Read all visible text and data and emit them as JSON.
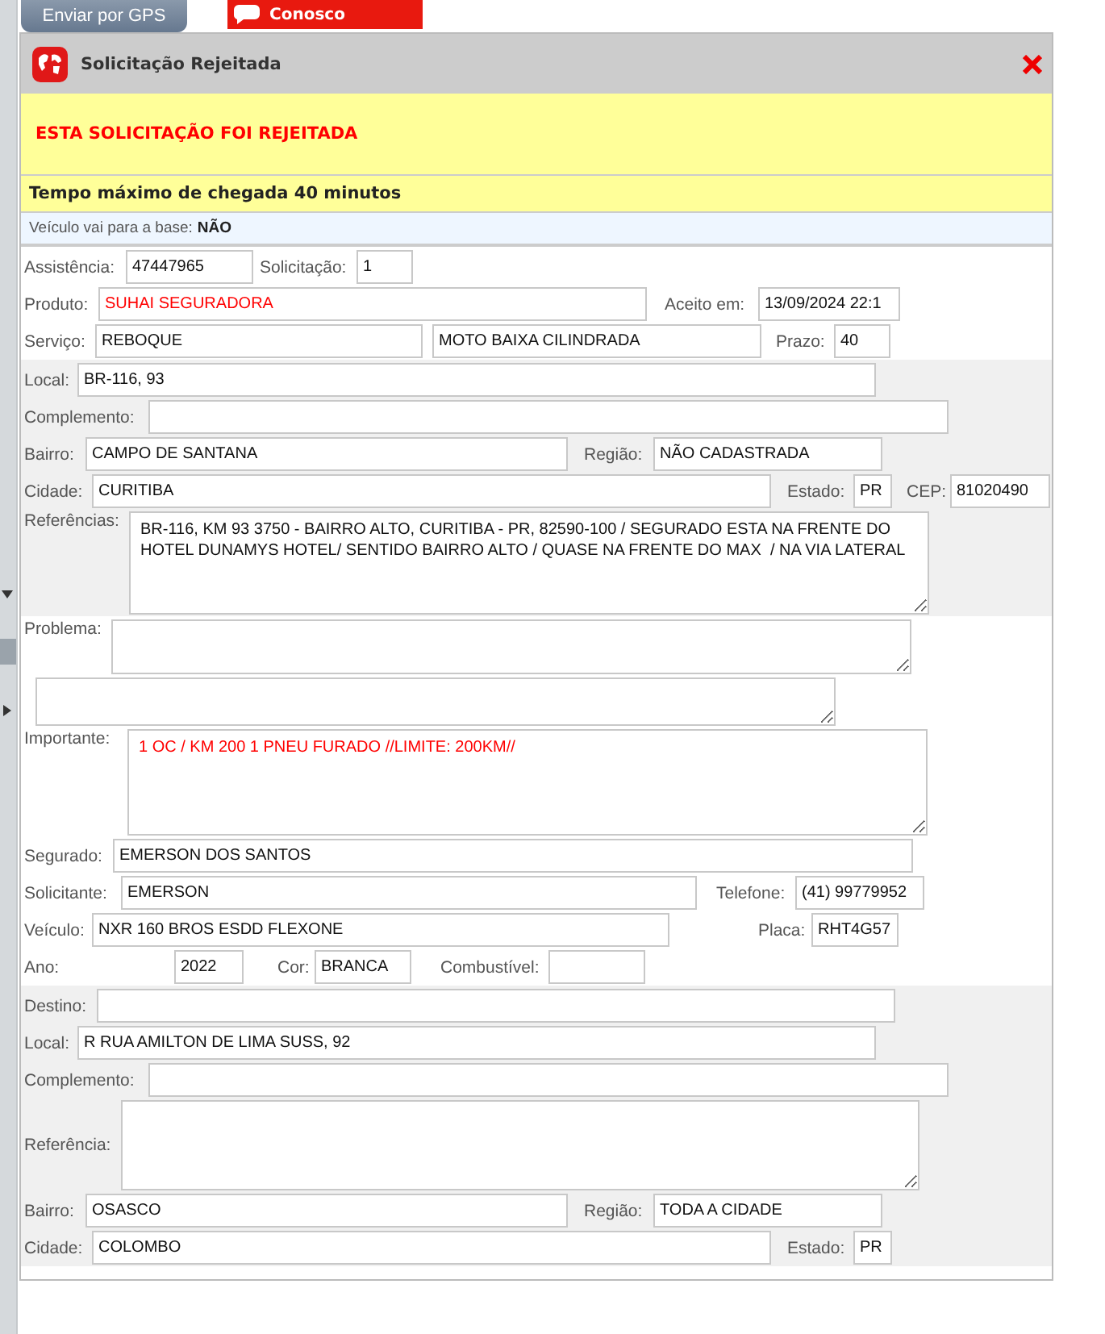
{
  "top_buttons": [
    {
      "kind": "gps",
      "label": "Enviar por GPS"
    },
    {
      "kind": "contact",
      "label": "Conosco"
    }
  ],
  "dialog": {
    "title": "Solicitação Rejeitada"
  },
  "alert": "ESTA SOLICITAÇÃO FOI REJEITADA",
  "arrival": "Tempo máximo de chegada 40 minutos",
  "base_note": {
    "label": "Veículo vai para a base:",
    "value": "NÃO"
  },
  "sections": [
    {
      "shaded": false,
      "lines": [
        {
          "fields": [
            {
              "label": "Assistência:",
              "value": "47447965"
            },
            {
              "label": "Solicitação:",
              "value": "1"
            }
          ]
        },
        {
          "fields": [
            {
              "label": "Produto:",
              "value": "SUHAI SEGURADORA",
              "alert": true
            },
            {
              "label": "Aceito em:",
              "value": "13/09/2024 22:1"
            }
          ]
        },
        {
          "fields": [
            {
              "label": "Serviço:",
              "value": "REBOQUE"
            },
            {
              "value": "MOTO BAIXA CILINDRADA"
            },
            {
              "label": "Prazo:",
              "value": "40"
            }
          ]
        }
      ]
    },
    {
      "shaded": true,
      "lines": [
        {
          "fields": [
            {
              "label": "Local:",
              "value": "BR-116, 93"
            }
          ]
        },
        {
          "fields": [
            {
              "label": "Complemento:"
            }
          ]
        },
        {
          "fields": [
            {
              "label": "Bairro:",
              "value": "CAMPO DE SANTANA"
            },
            {
              "label": "Região:",
              "value": "NÃO CADASTRADA"
            }
          ]
        },
        {
          "fields": [
            {
              "label": "Cidade:",
              "value": "CURITIBA"
            },
            {
              "label": "Estado:",
              "value": "PR"
            },
            {
              "label": "CEP:",
              "value": "81020490"
            }
          ]
        },
        {
          "fields": [
            {
              "label": "Referências:",
              "kind": "area",
              "value": "BR-116, KM 93 3750 - BAIRRO ALTO, CURITIBA - PR, 82590-100 / SEGURADO ESTA NA FRENTE DO HOTEL DUNAMYS HOTEL/ SENTIDO BAIRRO ALTO / QUASE NA FRENTE DO MAX  / NA VIA LATERAL"
            }
          ]
        }
      ]
    },
    {
      "shaded": false,
      "lines": [
        {
          "fields": [
            {
              "label": "Problema:",
              "kind": "area"
            }
          ]
        },
        {
          "fields": [
            {
              "kind": "area"
            }
          ]
        },
        {
          "fields": [
            {
              "label": "Importante:",
              "kind": "area",
              "value": "1 OC / KM 200 1 PNEU FURADO //LIMITE: 200KM//",
              "alert": true
            }
          ]
        },
        {
          "fields": [
            {
              "label": "Segurado:",
              "value": "EMERSON DOS SANTOS"
            }
          ]
        },
        {
          "fields": [
            {
              "label": "Solicitante:",
              "value": "EMERSON"
            },
            {
              "label": "Telefone:",
              "value": "(41) 99779952"
            }
          ]
        },
        {
          "fields": [
            {
              "label": "Veículo:",
              "value": "NXR 160 BROS ESDD FLEXONE"
            },
            {
              "label": "Placa:",
              "value": "RHT4G57"
            }
          ]
        },
        {
          "fields": [
            {
              "label": "Ano:",
              "value": "2022"
            },
            {
              "label": "Cor:",
              "value": "BRANCA"
            },
            {
              "label": "Combustível:"
            }
          ]
        }
      ]
    },
    {
      "shaded": true,
      "lines": [
        {
          "fields": [
            {
              "label": "Destino:"
            }
          ]
        },
        {
          "fields": [
            {
              "label": "Local:",
              "value": "R RUA AMILTON DE LIMA SUSS, 92"
            }
          ]
        },
        {
          "fields": [
            {
              "label": "Complemento:"
            }
          ]
        },
        {
          "fields": [
            {
              "label": "Referência:",
              "kind": "area"
            }
          ]
        },
        {
          "fields": [
            {
              "label": "Bairro:",
              "value": "OSASCO"
            },
            {
              "label": "Região:",
              "value": "TODA A CIDADE"
            }
          ]
        },
        {
          "fields": [
            {
              "label": "Cidade:",
              "value": "COLOMBO"
            },
            {
              "label": "Estado:",
              "value": "PR"
            }
          ]
        }
      ]
    }
  ]
}
